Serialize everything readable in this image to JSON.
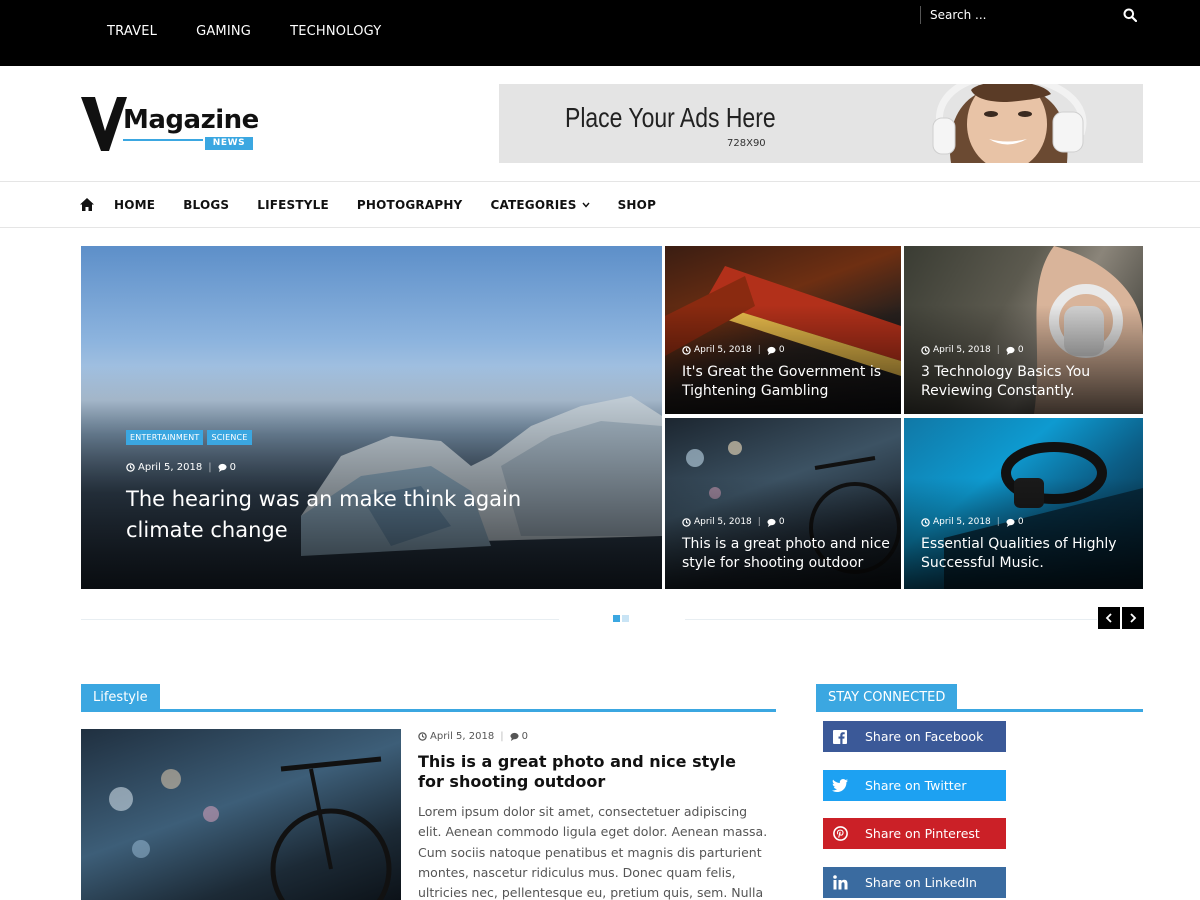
{
  "topbar": {
    "nav": [
      "TRAVEL",
      "GAMING",
      "TECHNOLOGY"
    ],
    "search_placeholder": "Search ..."
  },
  "header": {
    "logo_word": "Magazine",
    "logo_badge": "NEWS",
    "ad": {
      "title": "Place Your Ads Here",
      "size": "728X90"
    }
  },
  "mainnav": {
    "items": [
      "HOME",
      "BLOGS",
      "LIFESTYLE",
      "PHOTOGRAPHY",
      "CATEGORIES",
      "SHOP"
    ]
  },
  "slider": {
    "featured": {
      "tags": [
        "ENTERTAINMENT",
        "SCIENCE"
      ],
      "date": "April 5, 2018",
      "comments": "0",
      "title": "The hearing was an make think again climate change"
    },
    "tiles": [
      {
        "date": "April 5, 2018",
        "comments": "0",
        "title": "It's Great the Government is Tightening Gambling"
      },
      {
        "date": "April 5, 2018",
        "comments": "0",
        "title": "3 Technology Basics You Reviewing Constantly."
      },
      {
        "date": "April 5, 2018",
        "comments": "0",
        "title": "This is a great photo and nice style for shooting outdoor"
      },
      {
        "date": "April 5, 2018",
        "comments": "0",
        "title": "Essential Qualities of Highly Successful Music."
      }
    ]
  },
  "lifestyle": {
    "heading": "Lifestyle",
    "post": {
      "date": "April 5, 2018",
      "comments": "0",
      "title": "This is a great photo and nice style for shooting outdoor",
      "excerpt": "Lorem ipsum dolor sit amet, consectetuer adipiscing elit. Aenean commodo ligula eget dolor. Aenean massa. Cum sociis natoque penatibus et magnis dis parturient montes, nascetur ridiculus mus. Donec quam felis, ultricies nec, pellentesque eu, pretium quis, sem. Nulla consequat massa"
    }
  },
  "sidebar": {
    "heading": "STAY CONNECTED",
    "social": [
      {
        "label": "Share on Facebook",
        "icon": "facebook-icon",
        "color": "#3b5998"
      },
      {
        "label": "Share on Twitter",
        "icon": "twitter-icon",
        "color": "#1da1f2"
      },
      {
        "label": "Share on Pinterest",
        "icon": "pinterest-icon",
        "color": "#cb2027"
      },
      {
        "label": "Share on LinkedIn",
        "icon": "linkedin-icon",
        "color": "#3a6ba0"
      }
    ]
  },
  "theme": {
    "accent": "#3ba7e1",
    "topbar_bg": "#000000"
  }
}
